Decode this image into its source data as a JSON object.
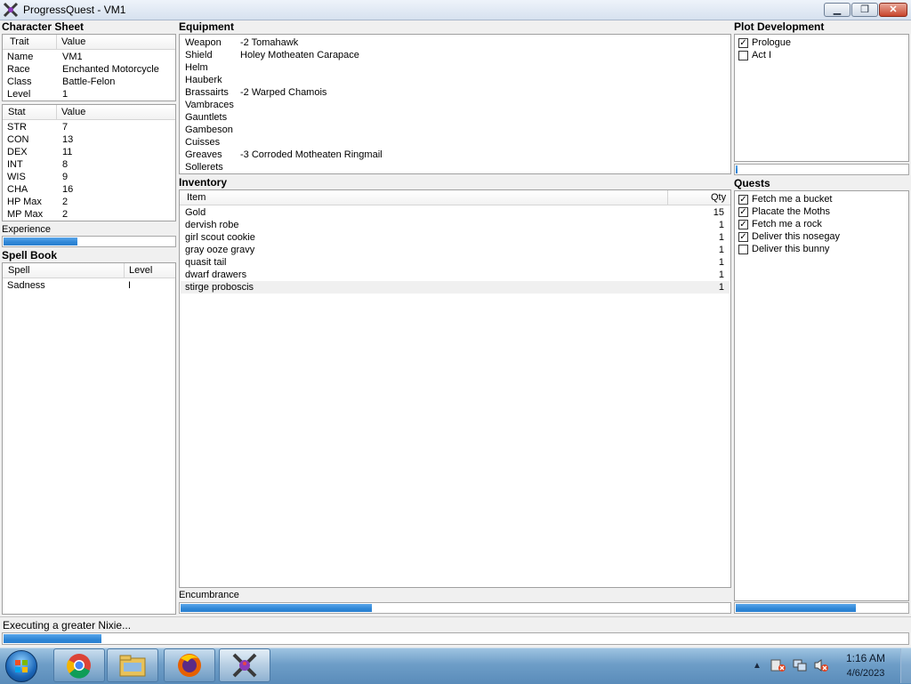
{
  "window": {
    "title": "ProgressQuest - VM1",
    "min": "▁",
    "max": "❐",
    "close": "✕"
  },
  "character": {
    "heading": "Character Sheet",
    "cols": [
      "Trait",
      "Value"
    ],
    "traits": [
      {
        "k": "Name",
        "v": "VM1"
      },
      {
        "k": "Race",
        "v": "Enchanted Motorcycle"
      },
      {
        "k": "Class",
        "v": "Battle-Felon"
      },
      {
        "k": "Level",
        "v": "1"
      }
    ],
    "stat_cols": [
      "Stat",
      "Value"
    ],
    "stats": [
      {
        "k": "STR",
        "v": "7"
      },
      {
        "k": "CON",
        "v": "13"
      },
      {
        "k": "DEX",
        "v": "11"
      },
      {
        "k": "INT",
        "v": "8"
      },
      {
        "k": "WIS",
        "v": "9"
      },
      {
        "k": "CHA",
        "v": "16"
      },
      {
        "k": "HP Max",
        "v": "2"
      },
      {
        "k": "MP Max",
        "v": "2"
      }
    ],
    "experience_label": "Experience",
    "experience_progress": 0.44
  },
  "spellbook": {
    "heading": "Spell Book",
    "cols": [
      "Spell",
      "Level"
    ],
    "spells": [
      {
        "k": "Sadness",
        "v": "I"
      }
    ]
  },
  "equipment": {
    "heading": "Equipment",
    "items": [
      {
        "k": "Weapon",
        "v": "-2 Tomahawk"
      },
      {
        "k": "Shield",
        "v": "Holey Motheaten Carapace"
      },
      {
        "k": "Helm",
        "v": ""
      },
      {
        "k": "Hauberk",
        "v": ""
      },
      {
        "k": "Brassairts",
        "v": "-2 Warped Chamois"
      },
      {
        "k": "Vambraces",
        "v": ""
      },
      {
        "k": "Gauntlets",
        "v": ""
      },
      {
        "k": "Gambeson",
        "v": ""
      },
      {
        "k": "Cuisses",
        "v": ""
      },
      {
        "k": "Greaves",
        "v": "-3 Corroded Motheaten Ringmail"
      },
      {
        "k": "Sollerets",
        "v": ""
      }
    ]
  },
  "inventory": {
    "heading": "Inventory",
    "cols": [
      "Item",
      "Qty"
    ],
    "items": [
      {
        "k": "Gold",
        "v": "15"
      },
      {
        "k": "dervish robe",
        "v": "1"
      },
      {
        "k": "girl scout cookie",
        "v": "1"
      },
      {
        "k": "gray ooze gravy",
        "v": "1"
      },
      {
        "k": "quasit tail",
        "v": "1"
      },
      {
        "k": "dwarf drawers",
        "v": "1"
      },
      {
        "k": "stirge proboscis",
        "v": "1"
      }
    ],
    "encumbrance_label": "Encumbrance",
    "encumbrance_progress": 0.35
  },
  "plot": {
    "heading": "Plot Development",
    "acts": [
      {
        "label": "Prologue",
        "checked": true
      },
      {
        "label": "Act I",
        "checked": false
      }
    ],
    "progress": 0.02
  },
  "quests": {
    "heading": "Quests",
    "items": [
      {
        "label": "Fetch me a bucket",
        "checked": true
      },
      {
        "label": "Placate the Moths",
        "checked": true
      },
      {
        "label": "Fetch me a rock",
        "checked": true
      },
      {
        "label": "Deliver this nosegay",
        "checked": true
      },
      {
        "label": "Deliver this bunny",
        "checked": false
      }
    ],
    "progress": 0.7
  },
  "status": {
    "text": "Executing a greater Nixie...",
    "progress": 0.11
  },
  "taskbar": {
    "apps": [
      "chrome-icon",
      "file-explorer-icon",
      "firefox-icon",
      "progressquest-icon"
    ],
    "time": "1:16 AM",
    "date": "4/6/2023",
    "tray": [
      "show-hidden-icons",
      "action-center-icon",
      "network-icon",
      "volume-muted-icon"
    ]
  },
  "colors": {
    "progress": "#2e86d6",
    "panel_border": "#a0a0a0"
  }
}
